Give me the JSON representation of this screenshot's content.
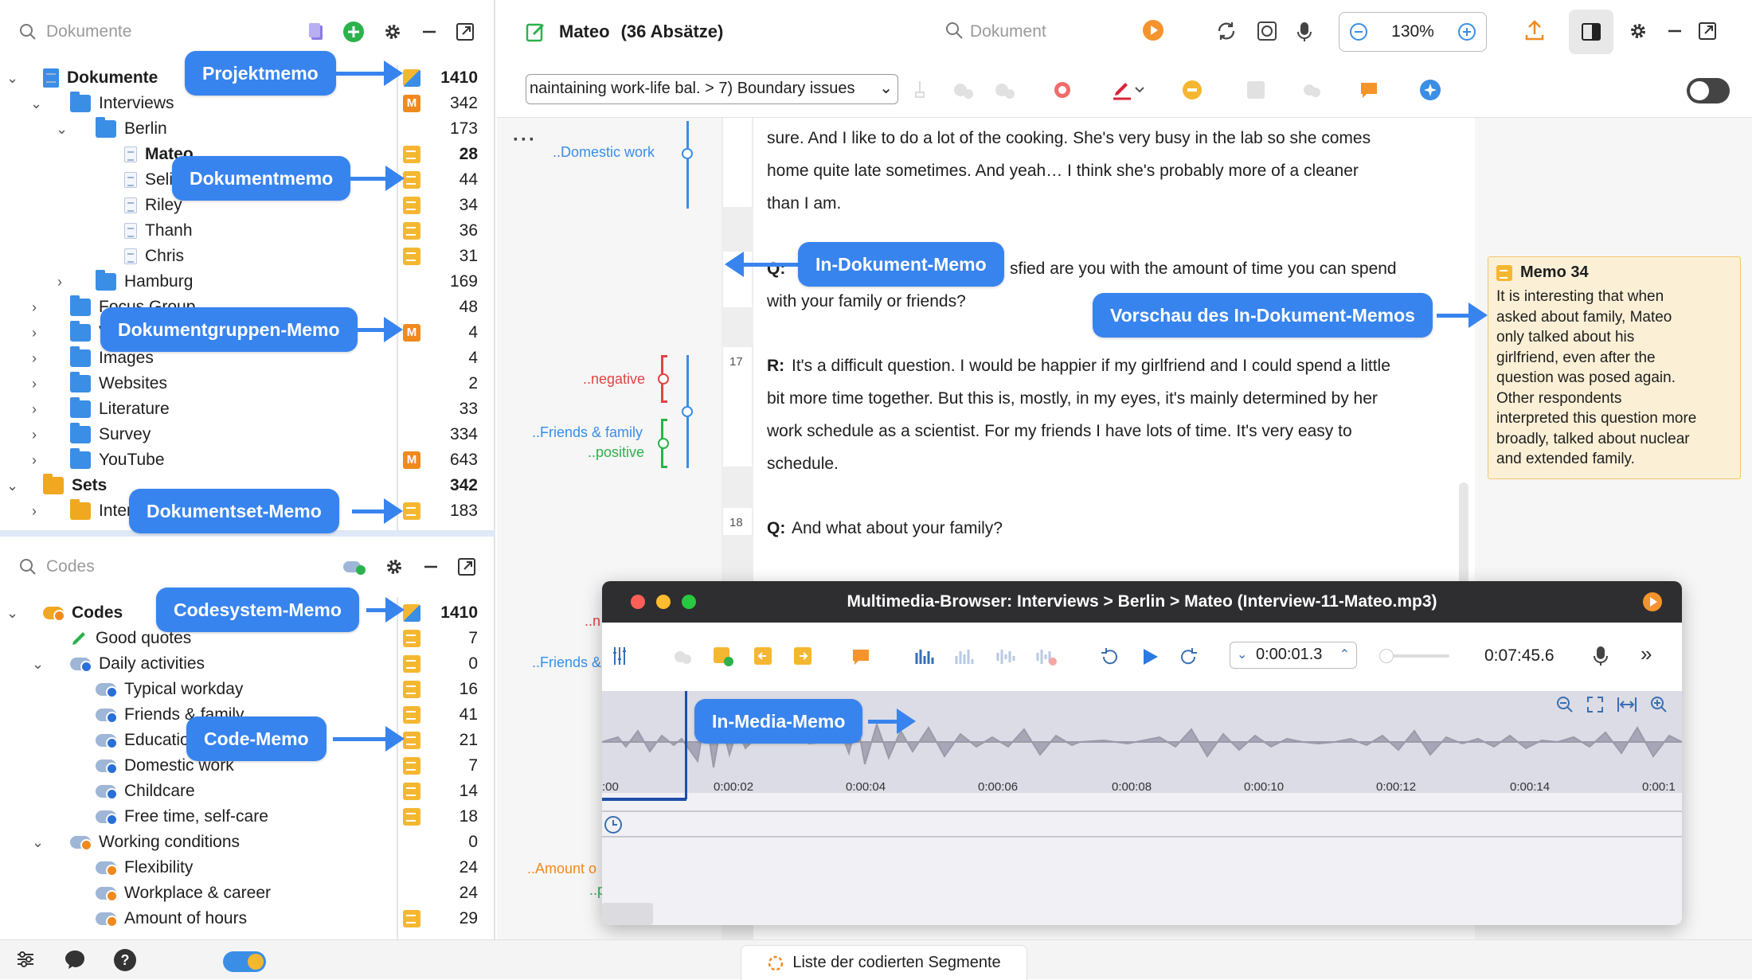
{
  "doc_panel": {
    "search_placeholder": "Dokumente"
  },
  "doc_tree": [
    {
      "label": "Dokumente",
      "count": "1410",
      "bold": true,
      "memo": "p"
    },
    {
      "label": "Interviews",
      "count": "342",
      "memo": "m"
    },
    {
      "label": "Berlin",
      "count": "173",
      "memo": ""
    },
    {
      "label": "Mateo",
      "count": "28",
      "bold": true,
      "memo": "y"
    },
    {
      "label": "Seli",
      "count": "44",
      "memo": "y"
    },
    {
      "label": "Riley",
      "count": "34",
      "memo": "y"
    },
    {
      "label": "Thanh",
      "count": "36",
      "memo": "y"
    },
    {
      "label": "Chris",
      "count": "31",
      "memo": "y"
    },
    {
      "label": "Hamburg",
      "count": "169",
      "memo": ""
    },
    {
      "label": "Focus Group",
      "count": "48",
      "memo": ""
    },
    {
      "label": "V",
      "count": "4",
      "memo": "m"
    },
    {
      "label": "Images",
      "count": "4",
      "memo": ""
    },
    {
      "label": "Websites",
      "count": "2",
      "memo": ""
    },
    {
      "label": "Literature",
      "count": "33",
      "memo": ""
    },
    {
      "label": "Survey",
      "count": "334",
      "memo": ""
    },
    {
      "label": "YouTube",
      "count": "643",
      "memo": "m"
    },
    {
      "label": "Sets",
      "count": "342",
      "bold": true,
      "memo": ""
    },
    {
      "label": "Inter",
      "count": "183",
      "memo": "y"
    }
  ],
  "code_panel": {
    "search_placeholder": "Codes"
  },
  "code_tree": [
    {
      "label": "Codes",
      "count": "1410",
      "bold": true,
      "memo": "p"
    },
    {
      "label": "Good quotes",
      "count": "7",
      "memo": "y"
    },
    {
      "label": "Daily activities",
      "count": "0",
      "memo": "y"
    },
    {
      "label": "Typical workday",
      "count": "16",
      "memo": "y"
    },
    {
      "label": "Friends & family",
      "count": "41",
      "memo": "y"
    },
    {
      "label": "Educatio",
      "count": "21",
      "memo": "y"
    },
    {
      "label": "Domestic work",
      "count": "7",
      "memo": "y"
    },
    {
      "label": "Childcare",
      "count": "14",
      "memo": "y"
    },
    {
      "label": "Free time, self-care",
      "count": "18",
      "memo": "y"
    },
    {
      "label": "Working conditions",
      "count": "0",
      "memo": ""
    },
    {
      "label": "Flexibility",
      "count": "24",
      "memo": ""
    },
    {
      "label": "Workplace & career",
      "count": "24",
      "memo": ""
    },
    {
      "label": "Amount of hours",
      "count": "29",
      "memo": "y"
    }
  ],
  "callouts": {
    "projektmemo": "Projektmemo",
    "dokumentmemo": "Dokumentmemo",
    "dokumentgruppen": "Dokumentgruppen-Memo",
    "dokumentset": "Dokumentset-Memo",
    "codesystem": "Codesystem-Memo",
    "codememo": "Code-Memo",
    "indokument": "In-Dokument-Memo",
    "vorschau": "Vorschau des In-Dokument-Memos",
    "inmedia": "In-Media-Memo"
  },
  "doc_view": {
    "title": "Mateo",
    "paragraphs": "(36 Absätze)",
    "search_placeholder": "Dokument",
    "zoom": "130%",
    "code_filter": "naintaining work-life bal. > 7) Boundary issues"
  },
  "margin_codes": {
    "domestic": "..Domestic work",
    "negative": "..negative",
    "friends": "..Friends & family",
    "positive": "..positive",
    "friends2": "..Friends &",
    "amount": "..Amount o",
    "p": "..p",
    "n": "..n"
  },
  "para_numbers": {
    "p17": "17",
    "p18": "18"
  },
  "text_lines": [
    "sure. And I like to do a lot of the cooking. She's very busy in the lab so she comes",
    "home quite late sometimes. And yeah… I think she's probably more of a cleaner",
    "than I am."
  ],
  "q1": {
    "label": "Q:",
    "text_after": "sfied are you with the amount of time you can spend",
    "line2": "with your family or friends?"
  },
  "r17": {
    "label": "R:",
    "line1": "It's a difficult question. I would be happier if my girlfriend and I could spend a little",
    "line2": "bit more time together. But this is, mostly, in my eyes, it's mainly determined by her",
    "line3": "work schedule as a scientist. For my friends I have lots of time. It's very easy to",
    "line4": "schedule."
  },
  "q18": {
    "label": "Q:",
    "text": "And what about your family?"
  },
  "memo_preview": {
    "title": "Memo 34",
    "lines": [
      "It is interesting that when",
      "asked about family, Mateo",
      "only talked about his",
      "girlfriend, even after the",
      "question was posed again.",
      "Other respondents",
      "interpreted this question more",
      "broadly, talked about nuclear",
      "and extended family."
    ]
  },
  "media": {
    "title": "Multimedia-Browser: Interviews > Berlin > Mateo (Interview-11-Mateo.mp3)",
    "position": "0:00:01.3",
    "duration": "0:07:45.6",
    "ticks": [
      ":00",
      "0:00:02",
      "0:00:04",
      "0:00:06",
      "0:00:08",
      "0:00:10",
      "0:00:12",
      "0:00:14",
      "0:00:1"
    ]
  },
  "bottom": {
    "segments_label": "Liste der codierten Segmente"
  }
}
